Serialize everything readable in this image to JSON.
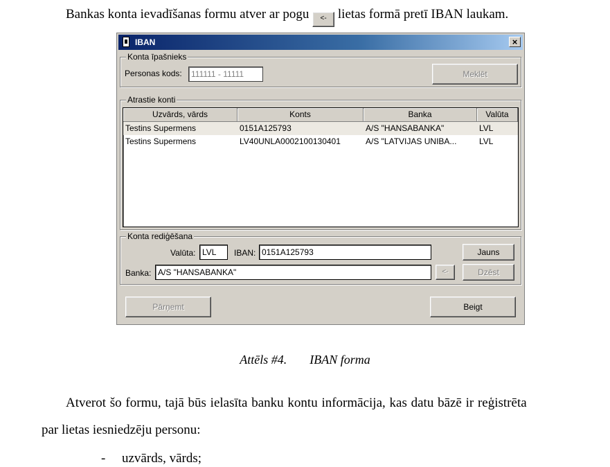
{
  "intro": {
    "before": "Bankas konta ievadīšanas formu atver ar pogu",
    "button_label": "<-",
    "after": "lietas formā pretī IBAN laukam."
  },
  "dialog": {
    "title": "IBAN",
    "close_label": "×",
    "owner_group": {
      "legend": "Konta īpašnieks",
      "personal_code_label": "Personas kods:",
      "personal_code_value": "111111 - 11111",
      "search_button": "Meklēt"
    },
    "found_group": {
      "legend": "Atrastie konti",
      "columns": [
        "Uzvārds, vārds",
        "Konts",
        "Banka",
        "Valūta"
      ],
      "rows": [
        [
          "Testins Supermens",
          "0151A125793",
          "A/S \"HANSABANKA\"",
          "LVL"
        ],
        [
          "Testins Supermens",
          "LV40UNLA0002100130401",
          "A/S \"LATVIJAS UNIBA...",
          "LVL"
        ]
      ]
    },
    "edit_group": {
      "legend": "Konta rediģēšana",
      "currency_label": "Valūta:",
      "currency_value": "LVL",
      "iban_label": "IBAN:",
      "iban_value": "0151A125793",
      "new_button": "Jauns",
      "bank_label": "Banka:",
      "bank_value": "A/S \"HANSABANKA\"",
      "arrow_button": "<-",
      "delete_button": "Dzēst"
    },
    "accept_button": "Pārņemt",
    "finish_button": "Beigt"
  },
  "caption": {
    "number": "Attēls #4.",
    "title": "IBAN forma"
  },
  "paragraph": {
    "line1": "Atverot šo formu, tajā būs ielasīta banku kontu informācija, kas datu bāzē ir reģistrēta",
    "line2": "par lietas iesniedzēju personu:",
    "bullet_dash": "-",
    "bullet_text": "uzvārds, vārds;"
  }
}
